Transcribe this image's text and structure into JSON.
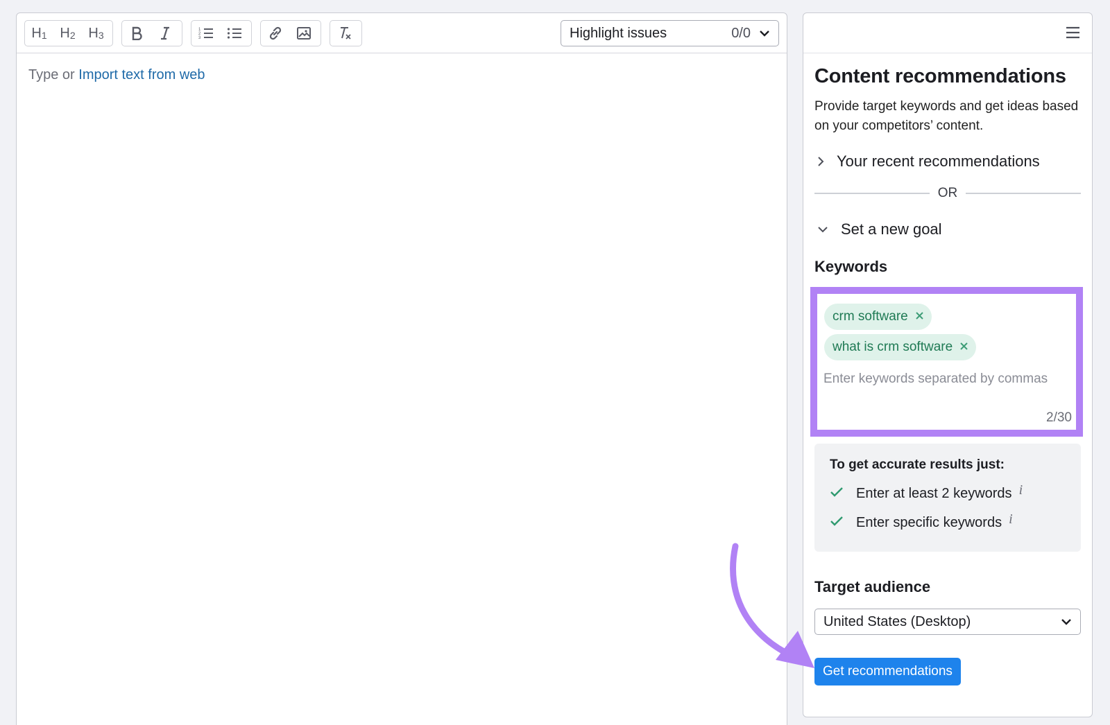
{
  "toolbar": {
    "headings": [
      {
        "label": "H",
        "sub": "1"
      },
      {
        "label": "H",
        "sub": "2"
      },
      {
        "label": "H",
        "sub": "3"
      }
    ],
    "highlight_label": "Highlight issues",
    "highlight_count": "0/0"
  },
  "editor": {
    "placeholder_prefix": "Type or ",
    "import_link": "Import text from web"
  },
  "sidebar": {
    "title": "Content recommendations",
    "description": "Provide target keywords and get ideas based on your competitors’ content.",
    "recent_label": "Your recent recommendations",
    "or_label": "OR",
    "new_goal_label": "Set a new goal",
    "keywords_label": "Keywords",
    "keywords": [
      {
        "text": "crm software"
      },
      {
        "text": "what is crm software"
      }
    ],
    "keyword_placeholder": "Enter keywords separated by commas",
    "keyword_counter": "2/30",
    "tips": {
      "title": "To get accurate results just:",
      "items": [
        {
          "text": "Enter at least 2 keywords"
        },
        {
          "text": "Enter specific keywords"
        }
      ]
    },
    "audience_label": "Target audience",
    "audience_value": "United States (Desktop)",
    "cta_label": "Get recommendations"
  },
  "colors": {
    "accent": "#1e83ec",
    "highlight_box": "#b182f5",
    "chip_bg": "#dff2ea",
    "chip_text": "#1f7a54"
  }
}
